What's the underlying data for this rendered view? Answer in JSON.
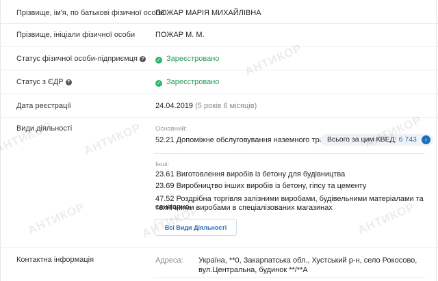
{
  "fields": {
    "fullname_label": "Прізвище, ім'я, по батькові фізичної особи",
    "fullname_value": "ПОЖАР МАРІЯ МИХАЙЛІВНА",
    "initials_label": "Прізвище, ініціали фізичної особи",
    "initials_value": "ПОЖАР М. М.",
    "fop_status_label": "Статус фізичної особи-підприємця",
    "fop_status_value": "Зареєстровано",
    "edr_status_label": "Статус з ЄДР",
    "edr_status_value": "Зареєстровано",
    "reg_date_label": "Дата реєстрації",
    "reg_date_value": "24.04.2019",
    "reg_date_age": "(5 років 6 місяців)",
    "activities_label": "Види діяльності",
    "main_label": "Основний:",
    "main_activity": "52.21 Допоміжне обслуговування наземного транспорту",
    "kved_total_label": "Всього за цим КВЕД:",
    "kved_total_value": "6 743",
    "other_label": "Інші:",
    "other_activities": [
      "23.61 Виготовлення виробів із бетону для будівництва",
      "23.69 Виробництво інших виробів із бетону, гіпсу та цементу",
      "47.52 Роздрібна торгівля залізними виробами, будівельними матеріалами та санітарно-",
      "технічними виробами в спеціалізованих магазинах"
    ],
    "all_activities_button": "Всі Види Діяльності",
    "contact_label": "Контактна інформація",
    "address_label": "Адреса:",
    "address_line1": "Україна, **0, Закарпатська обл., Хустський р-н, село Рокосово,",
    "address_line2": "вул.Центральна, будинок **/**А"
  },
  "watermark": "АНТИКОР",
  "colors": {
    "status_green": "#2a9a5a",
    "link_blue": "#2a6fb6",
    "arrow_blue": "#1f6fb8"
  },
  "icons": {
    "status": "check-circle-icon",
    "help": "question-circle-icon",
    "more": "chevron-right-icon"
  }
}
